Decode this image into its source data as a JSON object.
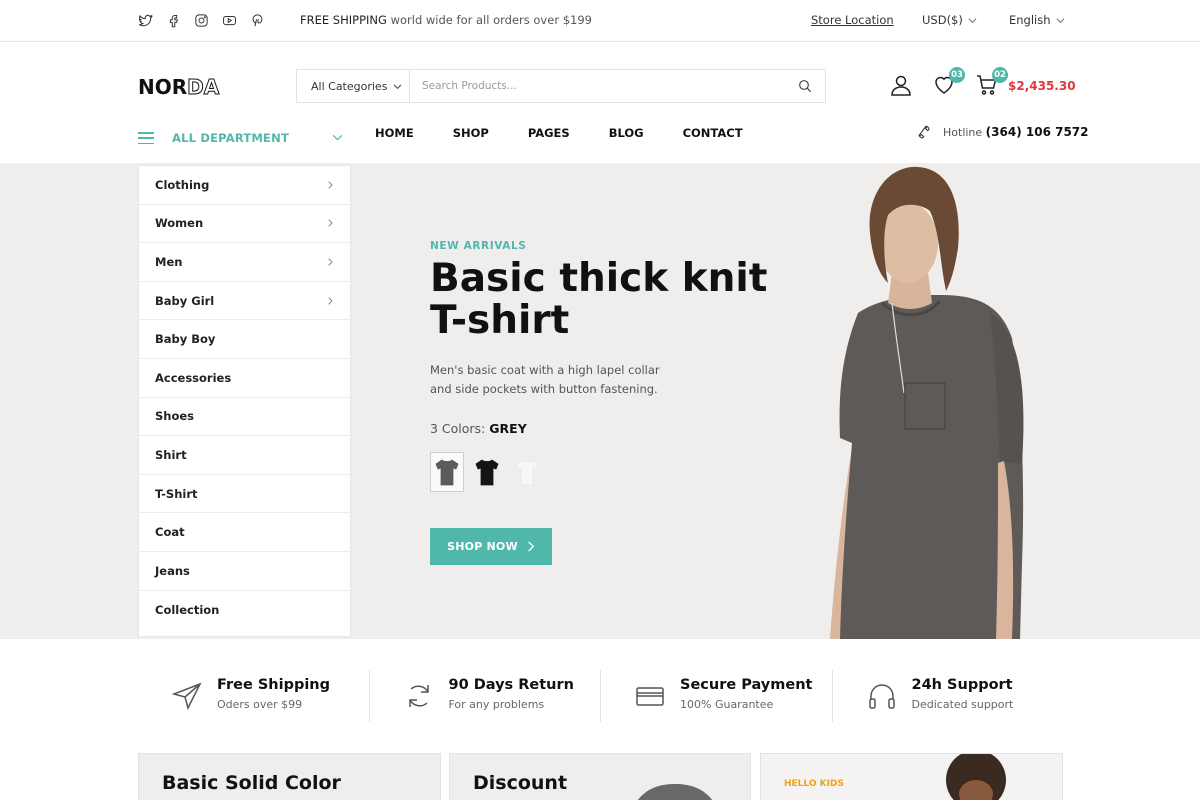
{
  "topbar": {
    "social": [
      "twitter-icon",
      "facebook-icon",
      "instagram-icon",
      "youtube-icon",
      "pinterest-icon"
    ],
    "shipping_strong": "FREE SHIPPING",
    "shipping_rest": " world wide for all orders over $199",
    "store_location": "Store Location",
    "currency": "USD($)",
    "language": "English"
  },
  "header": {
    "logo_solid": "NOR",
    "logo_outline": "DA",
    "category_select": "All Categories",
    "search_placeholder": "Search Products...",
    "wishlist_count": "03",
    "cart_count": "02",
    "cart_total": "$2,435.30"
  },
  "nav": {
    "department": "ALL DEPARTMENT",
    "items": [
      "HOME",
      "SHOP",
      "PAGES",
      "BLOG",
      "CONTACT"
    ],
    "hotline_label": "Hotline",
    "hotline_number": "(364) 106 7572"
  },
  "categories": [
    {
      "label": "Clothing",
      "has_sub": true
    },
    {
      "label": "Women",
      "has_sub": true
    },
    {
      "label": "Men",
      "has_sub": true
    },
    {
      "label": "Baby Girl",
      "has_sub": true
    },
    {
      "label": "Baby Boy",
      "has_sub": false
    },
    {
      "label": "Accessories",
      "has_sub": false
    },
    {
      "label": "Shoes",
      "has_sub": false
    },
    {
      "label": "Shirt",
      "has_sub": false
    },
    {
      "label": "T-Shirt",
      "has_sub": false
    },
    {
      "label": "Coat",
      "has_sub": false
    },
    {
      "label": "Jeans",
      "has_sub": false
    },
    {
      "label": "Collection",
      "has_sub": false
    }
  ],
  "hero": {
    "tag": "NEW ARRIVALS",
    "title_line1": "Basic thick knit",
    "title_line2": "T-shirt",
    "description": "Men's basic coat with a high lapel collar and side pockets with button fastening.",
    "colors_label": "3 Colors:",
    "colors_value": "GREY",
    "swatch_colors": [
      "#5d5a58",
      "#141414",
      "#f7f7f5"
    ],
    "cta": "SHOP NOW"
  },
  "features": [
    {
      "title": "Free Shipping",
      "subtitle": "Oders over $99",
      "icon": "paper-plane-icon"
    },
    {
      "title": "90 Days Return",
      "subtitle": "For any problems",
      "icon": "return-icon"
    },
    {
      "title": "Secure Payment",
      "subtitle": "100% Guarantee",
      "icon": "credit-card-icon"
    },
    {
      "title": "24h Support",
      "subtitle": "Dedicated support",
      "icon": "headphones-icon"
    }
  ],
  "promos": {
    "card1_title": "Basic Solid Color",
    "card2_title": "Discount",
    "card3_tag": "HELLO KIDS"
  },
  "colors": {
    "accent": "#4fb8ab",
    "price": "#e03838",
    "hero_bg": "#efeeec",
    "kids_tag": "#f0a020"
  }
}
